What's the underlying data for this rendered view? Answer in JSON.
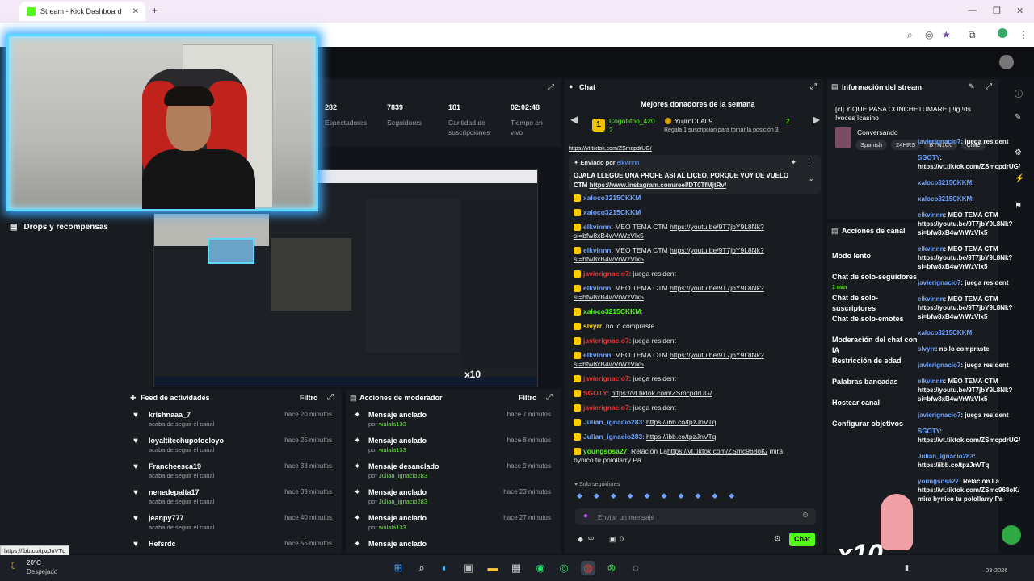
{
  "browser": {
    "tab_title": "Stream - Kick Dashboard",
    "new_tab": "+",
    "close_tab": "✕",
    "win_min": "—",
    "win_max": "❐",
    "win_close": "✕",
    "status_url": "https://ibb.co/tpzJnVTq"
  },
  "stats": [
    {
      "value": "282",
      "label": "Espectadores"
    },
    {
      "value": "7839",
      "label": "Seguidores"
    },
    {
      "value": "181",
      "label": "Cantidad de suscripciones"
    },
    {
      "value": "02:02:48",
      "label": "Tiempo en vivo"
    }
  ],
  "left_panel": {
    "drops_label": "Drops y recompensas"
  },
  "activity_feed": {
    "title": "Feed de actividades",
    "filter": "Filtro",
    "items": [
      {
        "name": "krishnaaa_7",
        "sub": "acaba de seguir el canal",
        "time": "hace 20 minutos"
      },
      {
        "name": "loyaltitechupotoeloyo",
        "sub": "acaba de seguir el canal",
        "time": "hace 25 minutos"
      },
      {
        "name": "Francheesca19",
        "sub": "acaba de seguir el canal",
        "time": "hace 38 minutos"
      },
      {
        "name": "nenedepalta17",
        "sub": "acaba de seguir el canal",
        "time": "hace 39 minutos"
      },
      {
        "name": "jeanpy777",
        "sub": "acaba de seguir el canal",
        "time": "hace 40 minutos"
      },
      {
        "name": "Hefsrdc",
        "sub": "",
        "time": "hace 55 minutos"
      }
    ]
  },
  "mod_actions": {
    "title": "Acciones de moderador",
    "filter": "Filtro",
    "items": [
      {
        "title": "Mensaje anclado",
        "by": "por ",
        "user": "walala133",
        "time": "hace 7 minutos"
      },
      {
        "title": "Mensaje anclado",
        "by": "por ",
        "user": "walala133",
        "time": "hace 8 minutos"
      },
      {
        "title": "Mensaje desanclado",
        "by": "por ",
        "user": "Julian_ignacio283",
        "time": "hace 9 minutos"
      },
      {
        "title": "Mensaje anclado",
        "by": "por ",
        "user": "Julian_ignacio283",
        "time": "hace 23 minutos"
      },
      {
        "title": "Mensaje anclado",
        "by": "por ",
        "user": "walala133",
        "time": "hace 27 minutos"
      },
      {
        "title": "Mensaje anclado",
        "by": "",
        "user": "",
        "time": ""
      }
    ]
  },
  "chat": {
    "title": "Chat",
    "donors_title": "Mejores donadores de la semana",
    "donor1_name": "Cogollitho_420",
    "donor1_count": "2",
    "donor2_name": "YujiroDLA09",
    "donor2_count": "2",
    "donor2_sub": "Regala 1 suscripción para tomar la posición 3",
    "pinned_by_label": "Enviado por",
    "pinned_by_user": "elkvinnn",
    "pinned_text": "OJALA LLEGUE UNA PROFE ASI AL LICEO, PORQUE VOY DE VUELO CTM ",
    "pinned_link": "https://www.instagram.com/reel/DT0TfMjtRv/",
    "top_link": "https://vt.tiktok.com/ZSmcpdrUG/",
    "messages": [
      {
        "user": "xaloco3215CKKM",
        "cls": "u-blue",
        "text": "",
        "link": ""
      },
      {
        "user": "xaloco3215CKKM",
        "cls": "u-blue",
        "text": "",
        "link": ""
      },
      {
        "user": "elkvinnn",
        "cls": "u-blue",
        "text": ": MEO TEMA CTM ",
        "link": "https://youtu.be/9T7jbY9L8Nk?si=bfw8xB4wVrWzVlx5"
      },
      {
        "user": "elkvinnn",
        "cls": "u-blue",
        "text": ": MEO TEMA CTM ",
        "link": "https://youtu.be/9T7jbY9L8Nk?si=bfw8xB4wVrWzVlx5"
      },
      {
        "user": "javierignacio7",
        "cls": "u-red",
        "text": ": juega resident",
        "link": ""
      },
      {
        "user": "elkvinnn",
        "cls": "u-blue",
        "text": ": MEO TEMA CTM ",
        "link": "https://youtu.be/9T7jbY9L8Nk?si=bfw8xB4wVrWzVlx5"
      },
      {
        "user": "xaloco3215CKKM",
        "cls": "u-green",
        "text": ": ",
        "link": ""
      },
      {
        "user": "slvyrr",
        "cls": "u-yel",
        "text": ": no lo compraste",
        "link": ""
      },
      {
        "user": "javierignacio7",
        "cls": "u-red",
        "text": ": juega resident",
        "link": ""
      },
      {
        "user": "elkvinnn",
        "cls": "u-blue",
        "text": ": MEO TEMA CTM ",
        "link": "https://youtu.be/9T7jbY9L8Nk?si=bfw8xB4wVrWzVlx5"
      },
      {
        "user": "javierignacio7",
        "cls": "u-red",
        "text": ": juega resident",
        "link": ""
      },
      {
        "user": "SGOTY",
        "cls": "u-red",
        "text": ": ",
        "link": "https://vt.tiktok.com/ZSmcpdrUG/"
      },
      {
        "user": "javierignacio7",
        "cls": "u-red",
        "text": ": juega resident",
        "link": ""
      },
      {
        "user": "Julian_ignacio283",
        "cls": "u-blue",
        "text": ": ",
        "link": "https://ibb.co/tpzJnVTq"
      },
      {
        "user": "Julian_ignacio283",
        "cls": "u-blue",
        "text": ": ",
        "link": "https://ibb.co/tpzJnVTq"
      },
      {
        "user": "youngsosa27",
        "cls": "u-green",
        "text": ": Relación La",
        "link": "https://vt.tiktok.com/ZSmc968oK/",
        "tail": " mira bynico tu polollarry Pa"
      }
    ],
    "followers_only": "Solo seguidores",
    "input_placeholder": "Enviar un mensaje",
    "infinity": "∞",
    "zero": "0",
    "send": "Chat"
  },
  "stream_info": {
    "title": "Información del stream",
    "stream_title": "[cl] Y QUE PASA CONCHETUMARE | !ig !ds !voces !casino",
    "category": "Conversando",
    "tags": [
      "Spanish",
      "24HRS",
      "BYN1C0",
      "Chile"
    ]
  },
  "channel_actions": {
    "title": "Acciones de canal",
    "items": [
      "Modo lento",
      "Chat de solo-seguidores",
      "Chat de solo-suscriptores",
      "Chat de solo-emotes",
      "Moderación del chat con IA",
      "Restricción de edad",
      "Palabras baneadas",
      "Hostear canal",
      "Configurar objetivos"
    ],
    "followers_sub": "1 min"
  },
  "side_chat": [
    {
      "u": "javierignacio7",
      "t": ": juega resident"
    },
    {
      "u": "SGOTY",
      "t": ": https://vt.tiktok.com/ZSmcpdrUG/"
    },
    {
      "u": "xaloco3215CKKM",
      "t": ": "
    },
    {
      "u": "xaloco3215CKKM",
      "t": ": "
    },
    {
      "u": "elkvinnn",
      "t": ": MEO TEMA CTM https://youtu.be/9T7jbY9L8Nk?si=bfw8xB4wVrWzVlx5"
    },
    {
      "u": "elkvinnn",
      "t": ": MEO TEMA CTM https://youtu.be/9T7jbY9L8Nk?si=bfw8xB4wVrWzVlx5"
    },
    {
      "u": "javierignacio7",
      "t": ": juega resident"
    },
    {
      "u": "elkvinnn",
      "t": ": MEO TEMA CTM https://youtu.be/9T7jbY9L8Nk?si=bfw8xB4wVrWzVlx5"
    },
    {
      "u": "xaloco3215CKKM",
      "t": ": "
    },
    {
      "u": "slvyrr",
      "t": ": no lo compraste"
    },
    {
      "u": "javierignacio7",
      "t": ": juega resident"
    },
    {
      "u": "elkvinnn",
      "t": ": MEO TEMA CTM https://youtu.be/9T7jbY9L8Nk?si=bfw8xB4wVrWzVlx5"
    },
    {
      "u": "javierignacio7",
      "t": ": juega resident"
    },
    {
      "u": "SGOTY",
      "t": ": https://vt.tiktok.com/ZSmcpdrUG/"
    },
    {
      "u": "Julian_ignacio283",
      "t": ": https://ibb.co/tpzJnVTq"
    },
    {
      "u": "youngsosa27",
      "t": ": Relación La https://vt.tiktok.com/ZSmc968oK/ mira bynico tu polollarry Pa"
    }
  ],
  "overlay": {
    "x10": "x10"
  },
  "taskbar": {
    "temp": "20°C",
    "weather": "Despejado",
    "date": "03-2026"
  }
}
